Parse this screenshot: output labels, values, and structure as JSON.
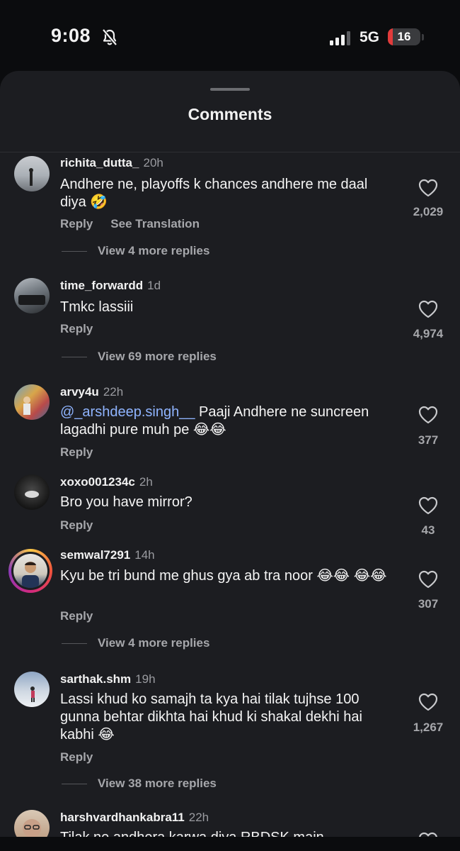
{
  "status": {
    "time": "9:08",
    "network": "5G",
    "battery": "16",
    "battery_fraction": 0.16
  },
  "sheet": {
    "title": "Comments"
  },
  "comments": [
    {
      "username": "richita_dutta_",
      "time": "20h",
      "text": "Andhere ne, playoffs k chances andhere me daal diya 🤣",
      "likes": "2,029",
      "reply_label": "Reply",
      "translate_label": "See Translation",
      "more_replies": "View 4 more replies"
    },
    {
      "username": "time_forwardd",
      "time": "1d",
      "text": "Tmkc lassiii",
      "likes": "4,974",
      "reply_label": "Reply",
      "more_replies": "View 69 more replies"
    },
    {
      "username": "arvy4u",
      "time": "22h",
      "mention": "@_arshdeep.singh__",
      "text": " Paaji Andhere ne suncreen lagadhi pure muh pe 😂😂",
      "likes": "377",
      "reply_label": "Reply"
    },
    {
      "username": "xoxo001234c",
      "time": "2h",
      "text": "Bro you have mirror?",
      "likes": "43",
      "reply_label": "Reply"
    },
    {
      "username": "semwal7291",
      "time": "14h",
      "text": "Kyu be tri bund me ghus gya ab tra noor 😂😂 😂😂",
      "likes": "307",
      "reply_label": "Reply",
      "more_replies": "View 4 more replies"
    },
    {
      "username": "sarthak.shm",
      "time": "19h",
      "text": "Lassi khud ko samajh ta kya hai tilak tujhse 100 gunna behtar dikhta hai khud ki shakal dekhi hai kabhi 😂",
      "likes": "1,267",
      "reply_label": "Reply",
      "more_replies": "View 38 more replies"
    },
    {
      "username": "harshvardhankabra11",
      "time": "22h",
      "text": "Tilak ne andhera karwa diya RBDSK main"
    }
  ],
  "icons": {
    "mute": "bell-slash-icon",
    "signal": "signal-bars-icon",
    "like": "heart-icon"
  },
  "colors": {
    "mention": "#8fb4ff",
    "battery_low": "#e23b3b",
    "sheet_bg": "#1c1d21"
  }
}
